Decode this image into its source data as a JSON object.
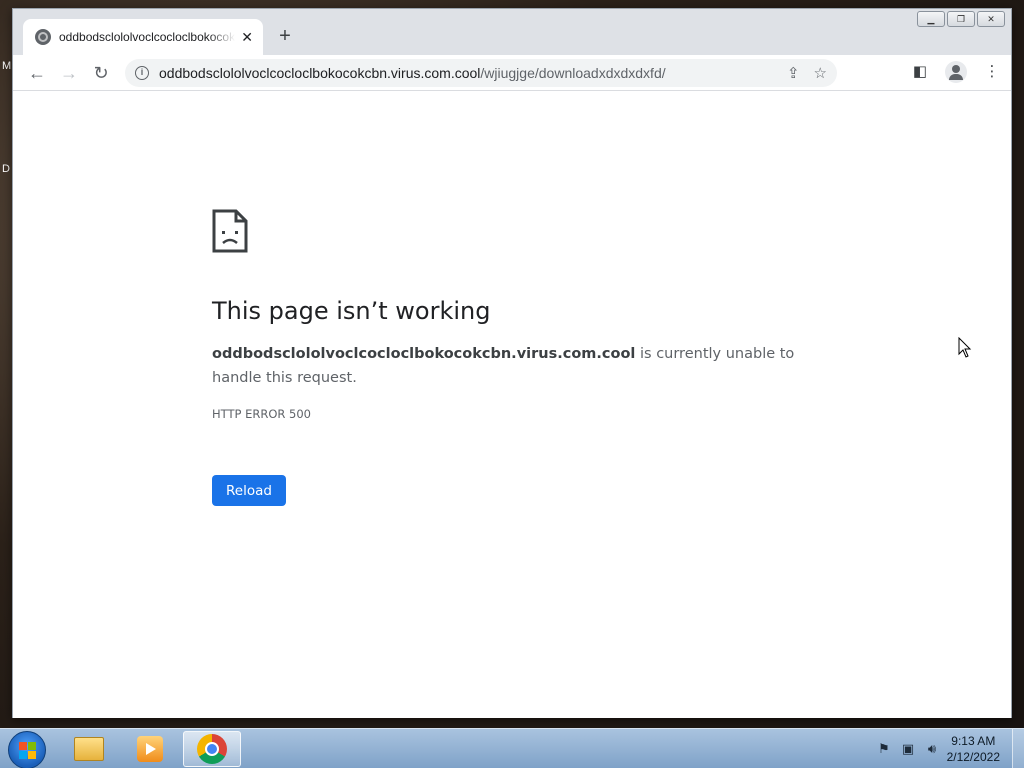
{
  "desktop": {
    "edge_label_1": "M",
    "edge_label_2": "D"
  },
  "browser": {
    "tab_title": "oddbodsclololvoclcocloclbokocokcbn.virus.com.cool",
    "url_host": "oddbodsclololvoclcocloclbokocokcbn.virus.com.cool",
    "url_path": "/wjiugjge/downloadxdxdxdxfd/",
    "window_controls": [
      "minimize",
      "maximize",
      "close"
    ]
  },
  "error_page": {
    "title": "This page isn’t working",
    "host": "oddbodsclololvoclcocloclbokocokcbn.virus.com.cool",
    "message": " is currently unable to handle this request.",
    "code": "HTTP ERROR 500",
    "reload_label": "Reload"
  },
  "taskbar": {
    "time": "9:13 AM",
    "date": "2/12/2022",
    "pinned": [
      "windows-explorer",
      "media-player",
      "google-chrome"
    ]
  },
  "colors": {
    "accent": "#1a73e8",
    "title_text": "#202124",
    "body_text": "#5f6368"
  }
}
